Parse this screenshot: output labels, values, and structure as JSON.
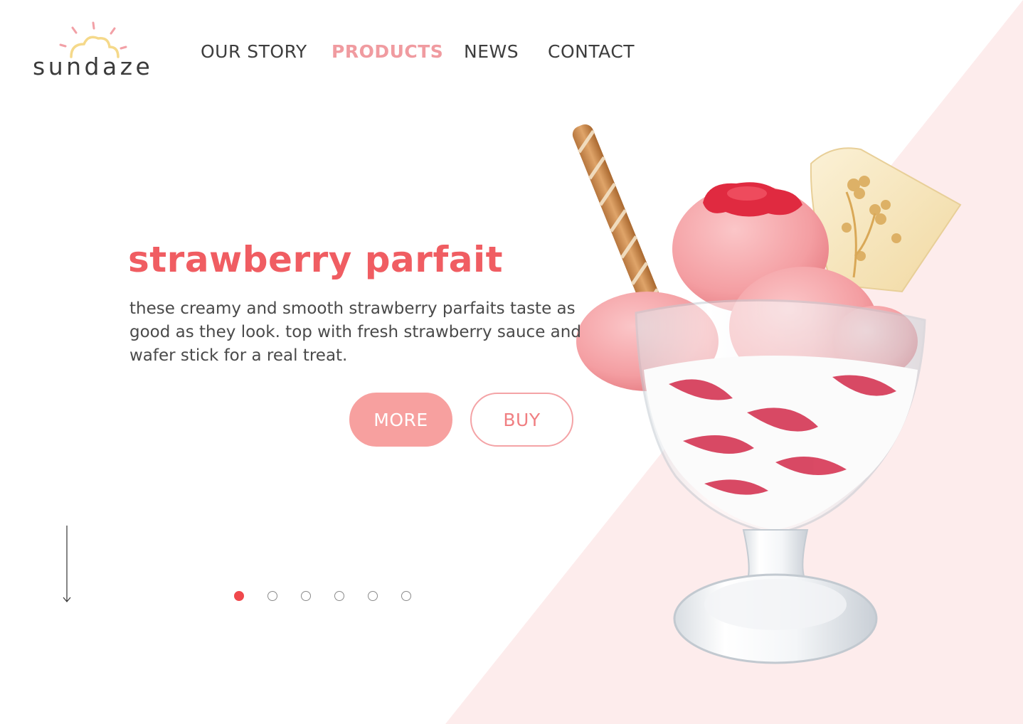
{
  "brand": {
    "name": "sundaze",
    "colors": {
      "accent": "#f05d62",
      "nav_active": "#f09ba0",
      "button_fill": "#f7a09f",
      "background_tint": "#fdecec",
      "sun": "#f5d98a",
      "rays": "#f2a0a6"
    }
  },
  "nav": {
    "items": [
      {
        "label": "OUR STORY",
        "active": false
      },
      {
        "label": "PRODUCTS",
        "active": true
      },
      {
        "label": "NEWS",
        "active": false
      },
      {
        "label": "CONTACT",
        "active": false
      }
    ]
  },
  "hero": {
    "title": "strawberry parfait",
    "description": "these creamy and smooth strawberry parfaits taste as good as they look. top with fresh strawberry sauce and wafer stick for a real treat.",
    "buttons": {
      "more": "MORE",
      "buy": "BUY"
    },
    "image_icon": "strawberry-sundae-image"
  },
  "carousel": {
    "total_slides": 6,
    "active_slide": 1
  },
  "scroll_indicator": {
    "icon": "arrow-down-icon"
  }
}
